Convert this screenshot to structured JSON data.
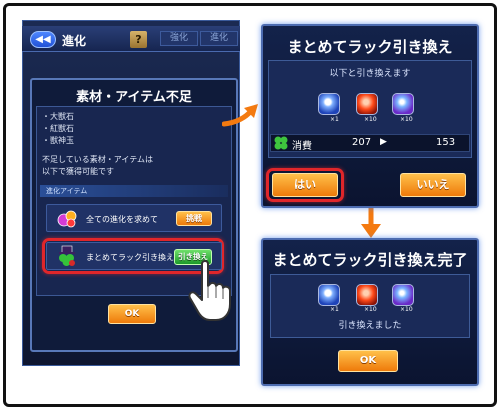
{
  "left": {
    "top_title": "進化",
    "help_label": "?",
    "back_label": "◀◀",
    "tabs": [
      "強化",
      "進化"
    ],
    "dialog_title": "素材・アイテム不足",
    "missing_items": [
      "・大獣石",
      "・紅獣石",
      "・獣神玉"
    ],
    "notice_lines": [
      "不足している素材・アイテムは",
      "以下で獲得可能です"
    ],
    "section_header": "進化アイテム",
    "row1_text": "全ての進化を求めて",
    "row1_button": "挑戦",
    "row2_text": "まとめてラック引き換え",
    "row2_button": "引き換え",
    "ok_label": "OK"
  },
  "exchange": {
    "title": "まとめてラック引き換え",
    "subtitle": "以下と引き換えます",
    "items": [
      {
        "icon": "blue-orb-icon",
        "qty": "×1"
      },
      {
        "icon": "red-stone-icon",
        "qty": "×10"
      },
      {
        "icon": "purple-orb-icon",
        "qty": "×10"
      }
    ],
    "cost_label": "消費",
    "cost_before": "207",
    "cost_after": "153",
    "yes_label": "はい",
    "no_label": "いいえ"
  },
  "complete": {
    "title": "まとめてラック引き換え完了",
    "items": [
      {
        "icon": "blue-orb-icon",
        "qty": "×1"
      },
      {
        "icon": "red-stone-icon",
        "qty": "×10"
      },
      {
        "icon": "purple-orb-icon",
        "qty": "×10"
      }
    ],
    "message": "引き換えました",
    "ok_label": "OK"
  },
  "colors": {
    "accent_orange": "#ee7a0a",
    "highlight_red": "#e0262a",
    "action_green": "#1c9a2a"
  }
}
